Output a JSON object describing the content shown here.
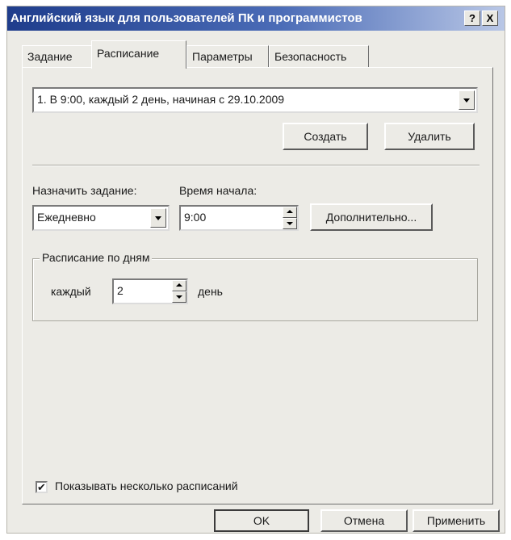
{
  "window": {
    "title": "Английский язык для пользователей ПК и программистов",
    "help_button": "?",
    "close_button": "X"
  },
  "tabs": [
    {
      "label": "Задание",
      "active": false
    },
    {
      "label": "Расписание",
      "active": true
    },
    {
      "label": "Параметры",
      "active": false
    },
    {
      "label": "Безопасность",
      "active": false
    }
  ],
  "schedule": {
    "selected": "1. В 9:00, каждый 2 день, начиная с 29.10.2009",
    "create_label": "Создать",
    "delete_label": "Удалить"
  },
  "task": {
    "assign_label": "Назначить задание:",
    "assign_value": "Ежедневно",
    "start_time_label": "Время начала:",
    "start_time_value": "9:00",
    "advanced_label": "Дополнительно..."
  },
  "daily": {
    "group_label": "Расписание по дням",
    "every_label": "каждый",
    "every_value": "2",
    "day_label": "день"
  },
  "multi_schedule": {
    "label": "Показывать несколько расписаний",
    "checked": true,
    "check_mark": "✔"
  },
  "footer": {
    "ok_label": "OK",
    "cancel_label": "Отмена",
    "apply_label": "Применить"
  }
}
